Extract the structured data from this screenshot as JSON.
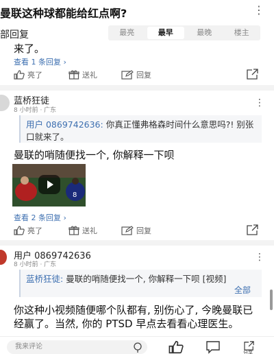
{
  "header": {
    "title": "曼联这种球都能给红点啊?",
    "more_glyph": "⋮"
  },
  "sortbar": {
    "reply_label": "部回复",
    "tabs": [
      "最亮",
      "最早",
      "最晚",
      "楼主"
    ],
    "active_tab": "最早"
  },
  "comment0": {
    "text_tail": "来了。",
    "view_replies": "查看 1 条回复",
    "actions": {
      "like": "亮了",
      "gift": "送礼",
      "reply": "回复"
    }
  },
  "comment1": {
    "username": "蓝桥狂徒",
    "meta": "8 小时前 · 广东",
    "quote_user": "用户 0869742636:",
    "quote_text": " 你真正懂弗格森时间什么意思吗?! 别张口就来了。",
    "text": "曼联的哨随便找一个, 你解释一下呗",
    "view_replies": "查看 2 条回复",
    "actions": {
      "like": "亮了",
      "gift": "送礼",
      "reply": "回复"
    }
  },
  "comment2": {
    "username": "用户 0869742636",
    "meta": "8 小时前 · 广东",
    "quote_user": "蓝桥狂徒:",
    "quote_text": " 曼联的哨随便找一个, 你解释一下呗 [视频]",
    "quote_expand": "全部",
    "text": "你这种小视频随便哪个队都有, 别伤心了, 今晚曼联已经赢了。当然, 你的 PTSD 早点去看看心理医生。"
  },
  "bottom": {
    "input_placeholder": "我来评论",
    "share_label": "分享"
  },
  "colors": {
    "link": "#3d6fb0",
    "quote_bg": "#f5f6f8"
  }
}
